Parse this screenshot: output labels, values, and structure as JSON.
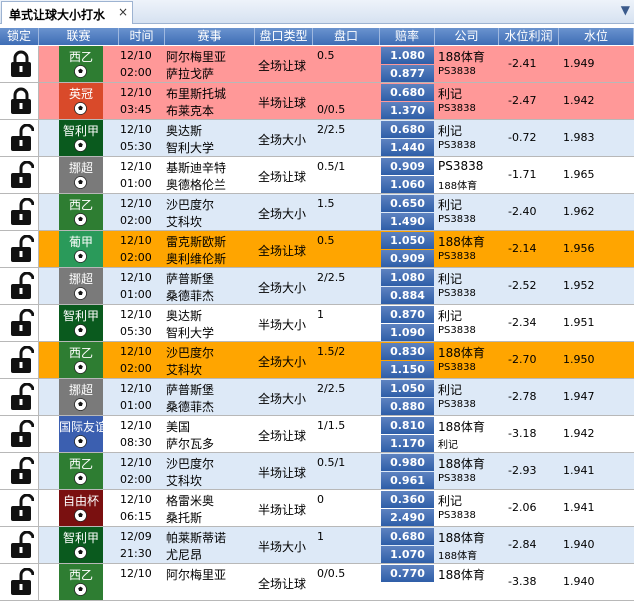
{
  "tab": {
    "title": "单式让球大小打水",
    "close": "×",
    "dropdown": "▼"
  },
  "columns": [
    "锁定",
    "联赛",
    "时间",
    "赛事",
    "盘口类型",
    "盘口",
    "赔率",
    "公司",
    "水位利润",
    "水位"
  ],
  "colors": {
    "red_row": "#ff9898",
    "orange_row": "#ffa500",
    "blue_row": "#dde9f7",
    "white_row": "#ffffff",
    "odds_blue": "#3a66b0"
  },
  "rows": [
    {
      "locked": true,
      "league": "西乙",
      "league_color": "#2e7d32",
      "date": "12/10",
      "time": "02:00",
      "home": "阿尔梅里亚",
      "away": "萨拉戈萨",
      "market": "全场让球",
      "line_top": "0.5",
      "line_bottom": "",
      "odds_top": "1.080",
      "odds_bottom": "0.877",
      "company_top": "188体育",
      "company_bottom": "PS3838",
      "profit": "-2.41",
      "water": "1.949",
      "bg": "#ff9898"
    },
    {
      "locked": true,
      "league": "英冠",
      "league_color": "#d94a2a",
      "date": "12/10",
      "time": "03:45",
      "home": "布里斯托城",
      "away": "布莱克本",
      "market": "半场让球",
      "line_top": "",
      "line_bottom": "0/0.5",
      "odds_top": "0.680",
      "odds_bottom": "1.370",
      "company_top": "利记",
      "company_bottom": "PS3838",
      "profit": "-2.47",
      "water": "1.942",
      "bg": "#ff9898"
    },
    {
      "locked": false,
      "league": "智利甲",
      "league_color": "#0a5a1e",
      "date": "12/10",
      "time": "05:30",
      "home": "奥达斯",
      "away": "智利大学",
      "market": "全场大小",
      "line_top": "2/2.5",
      "line_bottom": "",
      "odds_top": "0.680",
      "odds_bottom": "1.440",
      "company_top": "利记",
      "company_bottom": "PS3838",
      "profit": "-0.72",
      "water": "1.983",
      "bg": "#dde9f7"
    },
    {
      "locked": false,
      "league": "挪超",
      "league_color": "#7a7a7a",
      "date": "12/10",
      "time": "01:00",
      "home": "基斯迪辛特",
      "away": "奥德格伦兰",
      "market": "全场让球",
      "line_top": "0.5/1",
      "line_bottom": "",
      "odds_top": "0.909",
      "odds_bottom": "1.060",
      "company_top": "PS3838",
      "company_bottom": "188体育",
      "profit": "-1.71",
      "water": "1.965",
      "bg": "#ffffff"
    },
    {
      "locked": false,
      "league": "西乙",
      "league_color": "#2e7d32",
      "date": "12/10",
      "time": "02:00",
      "home": "沙巴度尔",
      "away": "艾科坎",
      "market": "全场大小",
      "line_top": "1.5",
      "line_bottom": "",
      "odds_top": "0.650",
      "odds_bottom": "1.490",
      "company_top": "利记",
      "company_bottom": "PS3838",
      "profit": "-2.40",
      "water": "1.962",
      "bg": "#dde9f7"
    },
    {
      "locked": false,
      "league": "葡甲",
      "league_color": "#2a9a5a",
      "date": "12/10",
      "time": "02:00",
      "home": "雷克斯欧斯",
      "away": "奥利维伦斯",
      "market": "全场让球",
      "line_top": "0.5",
      "line_bottom": "",
      "odds_top": "1.050",
      "odds_bottom": "0.909",
      "company_top": "188体育",
      "company_bottom": "PS3838",
      "profit": "-2.14",
      "water": "1.956",
      "bg": "#ffa500"
    },
    {
      "locked": false,
      "league": "挪超",
      "league_color": "#7a7a7a",
      "date": "12/10",
      "time": "01:00",
      "home": "萨普斯堡",
      "away": "桑德菲杰",
      "market": "全场大小",
      "line_top": "2/2.5",
      "line_bottom": "",
      "odds_top": "1.080",
      "odds_bottom": "0.884",
      "company_top": "利记",
      "company_bottom": "PS3838",
      "profit": "-2.52",
      "water": "1.952",
      "bg": "#dde9f7"
    },
    {
      "locked": false,
      "league": "智利甲",
      "league_color": "#0a5a1e",
      "date": "12/10",
      "time": "05:30",
      "home": "奥达斯",
      "away": "智利大学",
      "market": "半场大小",
      "line_top": "1",
      "line_bottom": "",
      "odds_top": "0.870",
      "odds_bottom": "1.090",
      "company_top": "利记",
      "company_bottom": "PS3838",
      "profit": "-2.34",
      "water": "1.951",
      "bg": "#ffffff"
    },
    {
      "locked": false,
      "league": "西乙",
      "league_color": "#2e7d32",
      "date": "12/10",
      "time": "02:00",
      "home": "沙巴度尔",
      "away": "艾科坎",
      "market": "全场大小",
      "line_top": "1.5/2",
      "line_bottom": "",
      "odds_top": "0.830",
      "odds_bottom": "1.150",
      "company_top": "188体育",
      "company_bottom": "PS3838",
      "profit": "-2.70",
      "water": "1.950",
      "bg": "#ffa500"
    },
    {
      "locked": false,
      "league": "挪超",
      "league_color": "#7a7a7a",
      "date": "12/10",
      "time": "01:00",
      "home": "萨普斯堡",
      "away": "桑德菲杰",
      "market": "全场大小",
      "line_top": "2/2.5",
      "line_bottom": "",
      "odds_top": "1.050",
      "odds_bottom": "0.880",
      "company_top": "利记",
      "company_bottom": "PS3838",
      "profit": "-2.78",
      "water": "1.947",
      "bg": "#dde9f7"
    },
    {
      "locked": false,
      "league": "国际友谊",
      "league_color": "#3b5fb0",
      "date": "12/10",
      "time": "08:30",
      "home": "美国",
      "away": "萨尔瓦多",
      "market": "全场让球",
      "line_top": "1/1.5",
      "line_bottom": "",
      "odds_top": "0.810",
      "odds_bottom": "1.170",
      "company_top": "188体育",
      "company_bottom": "利记",
      "profit": "-3.18",
      "water": "1.942",
      "bg": "#ffffff"
    },
    {
      "locked": false,
      "league": "西乙",
      "league_color": "#2e7d32",
      "date": "12/10",
      "time": "02:00",
      "home": "沙巴度尔",
      "away": "艾科坎",
      "market": "半场让球",
      "line_top": "0.5/1",
      "line_bottom": "",
      "odds_top": "0.980",
      "odds_bottom": "0.961",
      "company_top": "188体育",
      "company_bottom": "PS3838",
      "profit": "-2.93",
      "water": "1.941",
      "bg": "#dde9f7"
    },
    {
      "locked": false,
      "league": "自由杯",
      "league_color": "#7a1010",
      "date": "12/10",
      "time": "06:15",
      "home": "格雷米奥",
      "away": "桑托斯",
      "market": "半场让球",
      "line_top": "0",
      "line_bottom": "",
      "odds_top": "0.360",
      "odds_bottom": "2.490",
      "company_top": "利记",
      "company_bottom": "PS3838",
      "profit": "-2.06",
      "water": "1.941",
      "bg": "#ffffff"
    },
    {
      "locked": false,
      "league": "智利甲",
      "league_color": "#0a5a1e",
      "date": "12/09",
      "time": "21:30",
      "home": "帕莱斯蒂诺",
      "away": "尤尼昂",
      "market": "半场大小",
      "line_top": "1",
      "line_bottom": "",
      "odds_top": "0.680",
      "odds_bottom": "1.070",
      "company_top": "188体育",
      "company_bottom": "188体育",
      "profit": "-2.84",
      "water": "1.940",
      "bg": "#dde9f7"
    },
    {
      "locked": false,
      "league": "西乙",
      "league_color": "#2e7d32",
      "date": "12/10",
      "time": "",
      "home": "阿尔梅里亚",
      "away": "",
      "market": "全场让球",
      "line_top": "0/0.5",
      "line_bottom": "",
      "odds_top": "0.770",
      "odds_bottom": "",
      "company_top": "188体育",
      "company_bottom": "",
      "profit": "-3.38",
      "water": "1.940",
      "bg": "#ffffff"
    }
  ]
}
